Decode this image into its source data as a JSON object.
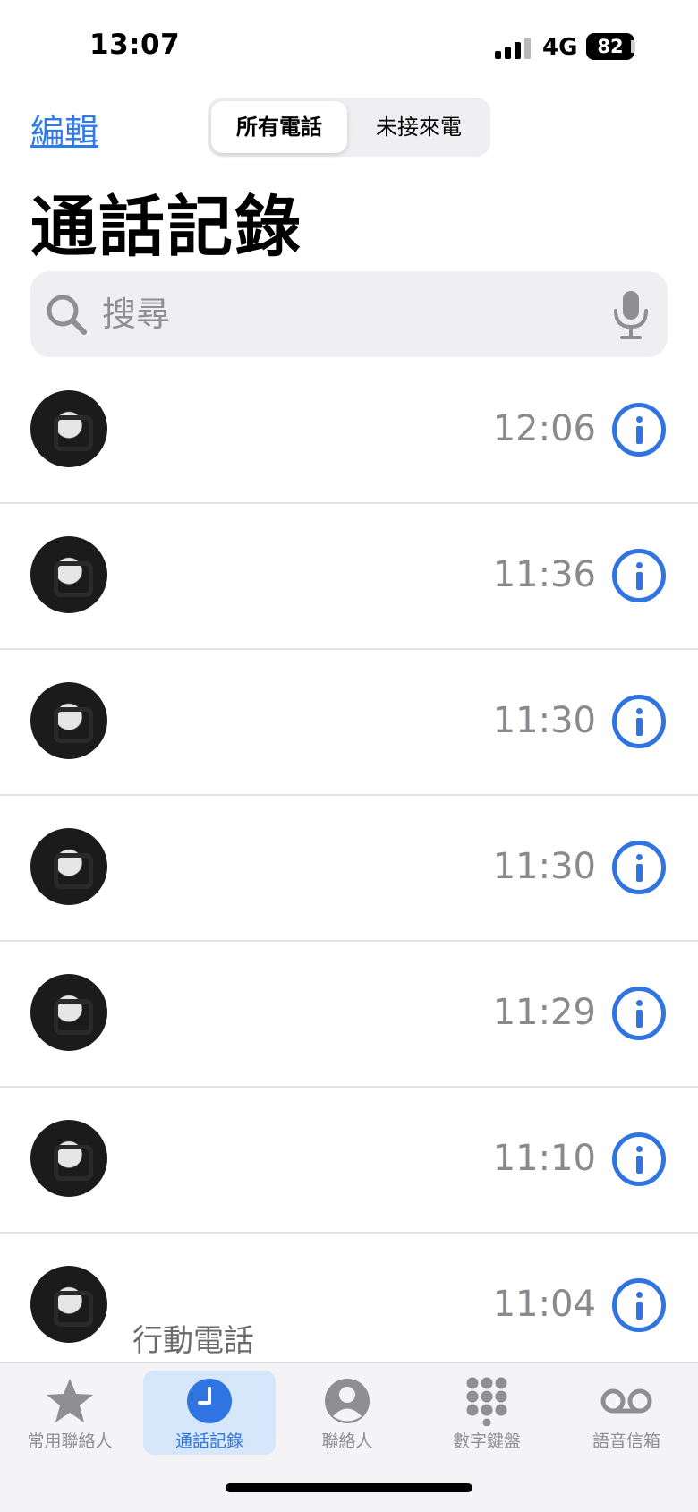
{
  "status_bar": {
    "time": "13:07",
    "network": "4G",
    "battery": "82"
  },
  "header": {
    "edit_label": "編輯",
    "segments": [
      "所有電話",
      "未接來電"
    ],
    "selected_segment": "所有電話",
    "title": "通話記錄"
  },
  "search": {
    "placeholder": "搜尋"
  },
  "calls": [
    {
      "name": "",
      "type": "",
      "time": "12:06"
    },
    {
      "name": "",
      "type": "",
      "time": "11:36"
    },
    {
      "name": "",
      "type": "",
      "time": "11:30"
    },
    {
      "name": "",
      "type": "",
      "time": "11:30"
    },
    {
      "name": "",
      "type": "",
      "time": "11:29"
    },
    {
      "name": "",
      "type": "",
      "time": "11:10"
    },
    {
      "name": "",
      "type": "行動電話",
      "time": "11:04"
    }
  ],
  "tab_bar": {
    "tabs": [
      {
        "label": "常用聯絡人",
        "icon": "star-icon"
      },
      {
        "label": "通話記錄",
        "icon": "clock-icon"
      },
      {
        "label": "聯絡人",
        "icon": "person-icon"
      },
      {
        "label": "數字鍵盤",
        "icon": "keypad-icon"
      },
      {
        "label": "語音信箱",
        "icon": "voicemail-icon"
      }
    ],
    "active": "通話記錄"
  },
  "colors": {
    "accent": "#2f74e0",
    "secondary_text": "#8a8a8e",
    "search_bg": "#efeff1"
  }
}
